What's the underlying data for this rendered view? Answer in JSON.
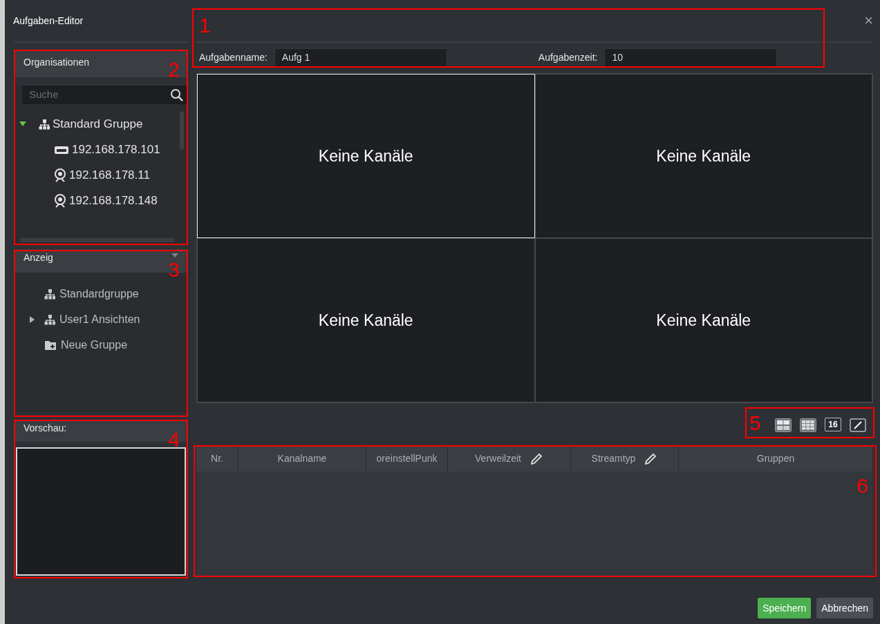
{
  "window": {
    "title": "Aufgaben-Editor",
    "close": "×"
  },
  "organisations": {
    "title": "Organisationen",
    "search": {
      "placeholder": "Suche"
    },
    "tree": [
      {
        "label": "Standard Gruppe",
        "kind": "group",
        "expanded": true,
        "children": [
          {
            "label": "192.168.178.101",
            "kind": "recorder"
          },
          {
            "label": "192.168.178.11",
            "kind": "camera"
          },
          {
            "label": "192.168.178.148",
            "kind": "camera"
          }
        ]
      }
    ]
  },
  "views": {
    "title": "Anzeig",
    "items": [
      {
        "label": "Standardgruppe",
        "kind": "group",
        "expandable": false
      },
      {
        "label": "User1 Ansichten",
        "kind": "group",
        "expandable": true
      },
      {
        "label": "Neue Gruppe",
        "kind": "new-folder",
        "expandable": false
      }
    ]
  },
  "preview": {
    "title": "Vorschau:"
  },
  "task": {
    "name_label": "Aufgabenname:",
    "name_value": "Aufg 1",
    "time_label": "Aufgabenzeit:",
    "time_value": "10"
  },
  "video_cells": [
    {
      "label": "Keine Kanäle",
      "selected": true
    },
    {
      "label": "Keine Kanäle",
      "selected": false
    },
    {
      "label": "Keine Kanäle",
      "selected": false
    },
    {
      "label": "Keine Kanäle",
      "selected": false
    }
  ],
  "layout_buttons": [
    {
      "kind": "grid-4"
    },
    {
      "kind": "grid-9"
    },
    {
      "kind": "grid-16",
      "label": "16"
    },
    {
      "kind": "edit"
    }
  ],
  "table": {
    "columns": [
      {
        "label": "Nr.",
        "editable": false
      },
      {
        "label": "Kanalname",
        "editable": false
      },
      {
        "label": "oreinstellPunk",
        "editable": false
      },
      {
        "label": "Verweilzeit",
        "editable": true
      },
      {
        "label": "Streamtyp",
        "editable": true
      },
      {
        "label": "Gruppen",
        "editable": false
      }
    ]
  },
  "buttons": [
    {
      "label": "Speichern",
      "kind": "primary"
    },
    {
      "label": "Abbrechen",
      "kind": "secondary"
    }
  ],
  "annotations": [
    {
      "label": "1"
    },
    {
      "label": "2"
    },
    {
      "label": "3"
    },
    {
      "label": "4"
    },
    {
      "label": "5"
    },
    {
      "label": "6"
    }
  ]
}
